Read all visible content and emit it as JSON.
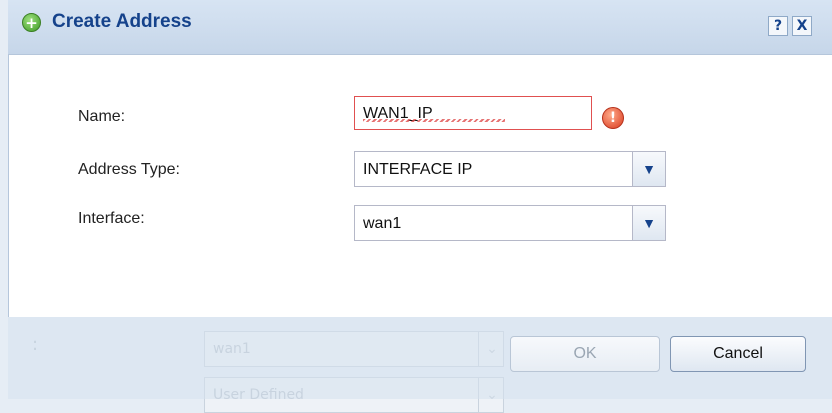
{
  "dialog": {
    "title": "Create Address",
    "help_label": "?",
    "close_label": "X"
  },
  "form": {
    "name_label": "Name:",
    "name_value": "WAN1_IP",
    "address_type_label": "Address Type:",
    "address_type_value": "INTERFACE IP",
    "interface_label": "Interface:",
    "interface_value": "wan1",
    "error_glyph": "!"
  },
  "buttons": {
    "ok_label": "OK",
    "cancel_label": "Cancel"
  },
  "background": {
    "field1_value": "wan1",
    "field2_value": "User Defined",
    "colon": ":"
  },
  "icons": {
    "add": "add-circle-icon",
    "error": "error-icon",
    "dropdown": "chevron-down-icon"
  },
  "colors": {
    "title_text": "#15428b",
    "error_border": "#e05050",
    "add_icon": "#3d9a24",
    "error_icon": "#d9391e"
  }
}
